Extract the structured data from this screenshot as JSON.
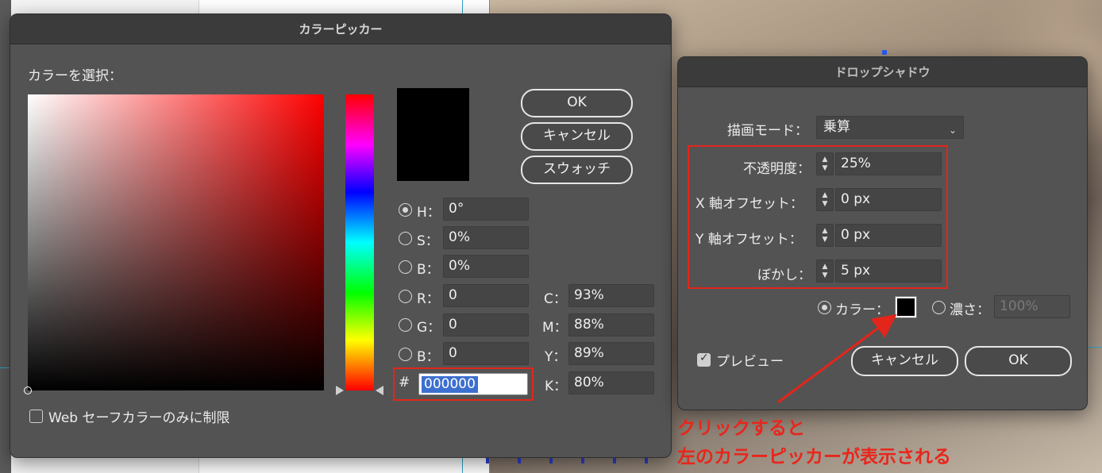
{
  "picker": {
    "title": "カラーピッカー",
    "select_label": "カラーを選択：",
    "fields": {
      "h_label": "H：",
      "h_value": "0°",
      "s_label": "S：",
      "s_value": "0%",
      "b_label": "B：",
      "b_value": "0%",
      "r_label": "R：",
      "r_value": "0",
      "g_label": "G：",
      "g_value": "0",
      "bl_label": "B：",
      "bl_value": "0",
      "c_label": "C：",
      "c_value": "93%",
      "m_label": "M：",
      "m_value": "88%",
      "y_label": "Y：",
      "y_value": "89%",
      "k_label": "K：",
      "k_value": "80%",
      "hex_label": "#",
      "hex_value": "000000"
    },
    "ok_label": "OK",
    "cancel_label": "キャンセル",
    "swatches_label": "スウォッチ",
    "web_safe_label": "Web セーフカラーのみに制限",
    "current_color": "#000000"
  },
  "shadow": {
    "title": "ドロップシャドウ",
    "mode_label": "描画モード：",
    "mode_value": "乗算",
    "opacity_label": "不透明度：",
    "opacity_value": "25%",
    "x_label": "X 軸オフセット：",
    "x_value": "0 px",
    "y_label": "Y 軸オフセット：",
    "y_value": "0 px",
    "blur_label": "ぼかし：",
    "blur_value": "5 px",
    "color_label": "カラー：",
    "darkness_label": "濃さ：",
    "darkness_value": "100%",
    "preview_label": "プレビュー",
    "cancel_label": "キャンセル",
    "ok_label": "OK"
  },
  "annotation": {
    "line1": "クリックすると",
    "line2": "左のカラーピッカーが表示される",
    "color": "#e4251b"
  }
}
